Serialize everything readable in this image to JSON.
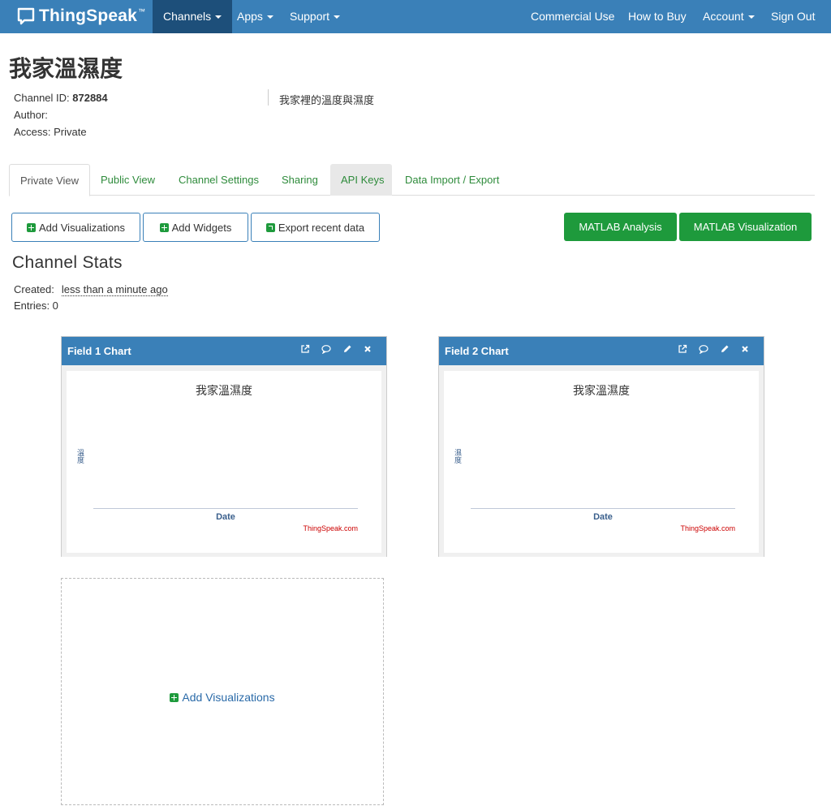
{
  "navbar": {
    "brand": "ThingSpeak",
    "brand_tm": "™",
    "left_items": [
      {
        "label": "Channels",
        "dropdown": true,
        "active": true
      },
      {
        "label": "Apps",
        "dropdown": true
      },
      {
        "label": "Support",
        "dropdown": true
      }
    ],
    "right_items": [
      {
        "label": "Commercial Use"
      },
      {
        "label": "How to Buy"
      },
      {
        "label": "Account",
        "dropdown": true
      },
      {
        "label": "Sign Out"
      }
    ]
  },
  "channel": {
    "title": "我家溫濕度",
    "id_label": "Channel ID: ",
    "id_value": "872884",
    "author_label": "Author:",
    "access_label": "Access: Private",
    "description": "我家裡的溫度與濕度"
  },
  "tabs": [
    {
      "label": "Private View",
      "active": true
    },
    {
      "label": "Public View"
    },
    {
      "label": "Channel Settings"
    },
    {
      "label": "Sharing"
    },
    {
      "label": "API Keys",
      "shaded": true
    },
    {
      "label": "Data Import / Export"
    }
  ],
  "actions": {
    "add_visualizations": "Add Visualizations",
    "add_widgets": "Add Widgets",
    "export_recent": "Export recent data",
    "matlab_analysis": "MATLAB Analysis",
    "matlab_visualization": "MATLAB Visualization"
  },
  "stats": {
    "title": "Channel Stats",
    "created_label": "Created:",
    "created_value": "less than a minute ago",
    "entries_label": "Entries: 0"
  },
  "charts": [
    {
      "header": "Field 1 Chart",
      "title": "我家溫濕度",
      "ylabel": "溫度",
      "xlabel": "Date",
      "credit": "ThingSpeak.com"
    },
    {
      "header": "Field 2 Chart",
      "title": "我家溫濕度",
      "ylabel": "濕度",
      "xlabel": "Date",
      "credit": "ThingSpeak.com"
    }
  ],
  "placeholder": {
    "add_visualizations": "Add Visualizations"
  },
  "colors": {
    "navbar": "#3a80b8",
    "navbar_active": "#1d4f7a",
    "green": "#1e9a3c",
    "tab_link": "#2e8b3b"
  }
}
